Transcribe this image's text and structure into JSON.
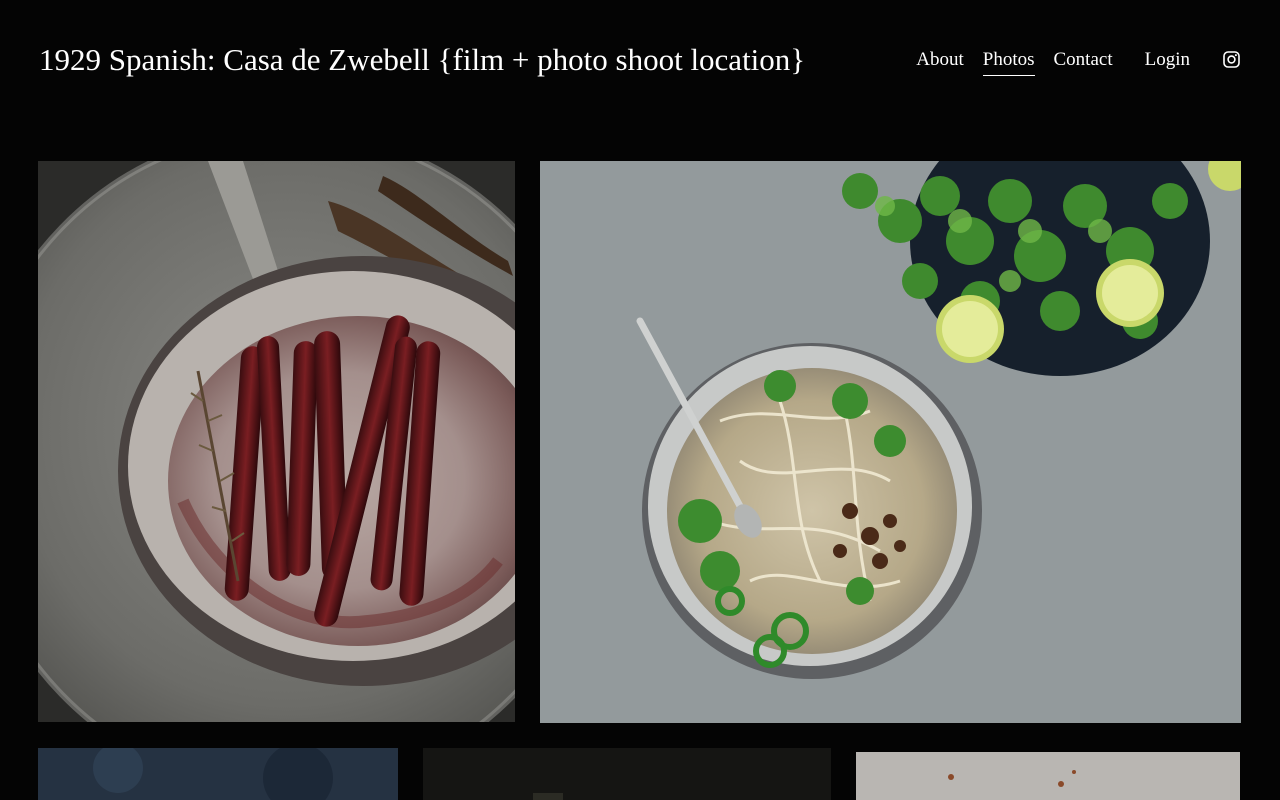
{
  "site": {
    "title": "1929 Spanish: Casa de Zwebell {film + photo shoot location}"
  },
  "nav": {
    "items": [
      {
        "label": "About",
        "active": false
      },
      {
        "label": "Photos",
        "active": true
      },
      {
        "label": "Contact",
        "active": false
      },
      {
        "label": "Login",
        "active": false
      }
    ],
    "social_icon": "instagram-icon"
  },
  "gallery": {
    "images": [
      {
        "subject": "roasted-carrots-in-pan",
        "icon": "photo"
      },
      {
        "subject": "pho-noodle-soup-with-herbs",
        "icon": "photo"
      },
      {
        "subject": "dark-blue-texture",
        "icon": "photo"
      },
      {
        "subject": "dark-food-scene",
        "icon": "photo"
      },
      {
        "subject": "light-grey-surface",
        "icon": "photo"
      }
    ]
  },
  "colors": {
    "background": "#040404",
    "text": "#ffffff"
  }
}
